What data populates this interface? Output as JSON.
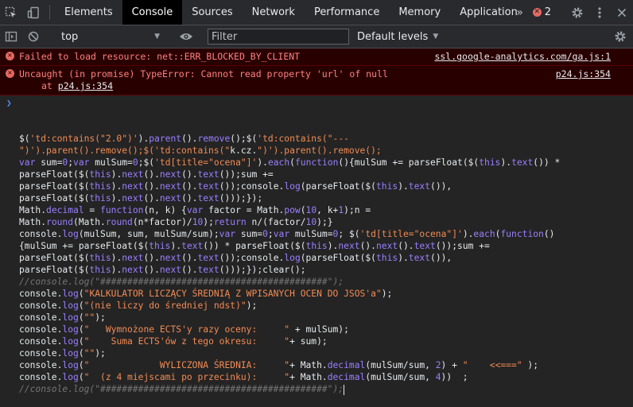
{
  "tabs": [
    "Elements",
    "Console",
    "Sources",
    "Network",
    "Performance",
    "Memory",
    "Application"
  ],
  "active_tab": "Console",
  "error_count": "2",
  "toolbar": {
    "context": "top",
    "filter_placeholder": "Filter",
    "levels": "Default levels"
  },
  "messages": [
    {
      "text": "Failed to load resource: net::ERR_BLOCKED_BY_CLIENT",
      "source": "ssl.google-analytics.com/ga.js:1"
    },
    {
      "text": "Uncaught (in promise) TypeError: Cannot read property 'url' of null",
      "source": "p24.js:354",
      "at_label": "at",
      "at_link": "p24.js:354"
    }
  ],
  "code_lines": [
    "$('td:contains(\"2.0\")').parent().remove();$('td:contains(\"---",
    "\")').parent().remove();$('td:contains(\"k.cz.\")').parent().remove();",
    "var sum=0;var mulSum=0;$('td[title=\"ocena\"]').each(function(){mulSum += parseFloat($(this).text()) *",
    "parseFloat($(this).next().next().text());sum +=",
    "parseFloat($(this).next().next().text());console.log(parseFloat($(this).text()),",
    "parseFloat($(this).next().next().text()));});",
    "Math.decimal = function(n, k) {var factor = Math.pow(10, k+1);n =",
    "Math.round(Math.round(n*factor)/10);return n/(factor/10);}",
    "console.log(mulSum, sum, mulSum/sum);var sum=0;var mulSum=0; $('td[title=\"ocena\"]').each(function()",
    "{mulSum += parseFloat($(this).text()) * parseFloat($(this).next().next().text());sum +=",
    "parseFloat($(this).next().next().text());console.log(parseFloat($(this).text()),",
    "parseFloat($(this).next().next().text()));});clear();",
    "//console.log(\"##########################################\");",
    "console.log(\"KALKULATOR LICZĄCY ŚREDNIĄ Z WPISANYCH OCEN DO JSOS'a\");",
    "console.log(\"(nie liczy do średniej ndst)\");",
    "console.log(\"\");",
    "console.log(\"   Wymnożone ECTS'y razy oceny:     \" + mulSum);",
    "console.log(\"    Suma ECTS'ów z tego okresu:     \"+ sum);",
    "console.log(\"\");",
    "console.log(\"             WYLICZONA ŚREDNIA:     \"+ Math.decimal(mulSum/sum, 2) + \"    <<===\" );",
    "console.log(\"  (z 4 miejscami po przecinku):     \"+ Math.decimal(mulSum/sum, 4))  ;",
    "//console.log(\"##########################################\");"
  ]
}
